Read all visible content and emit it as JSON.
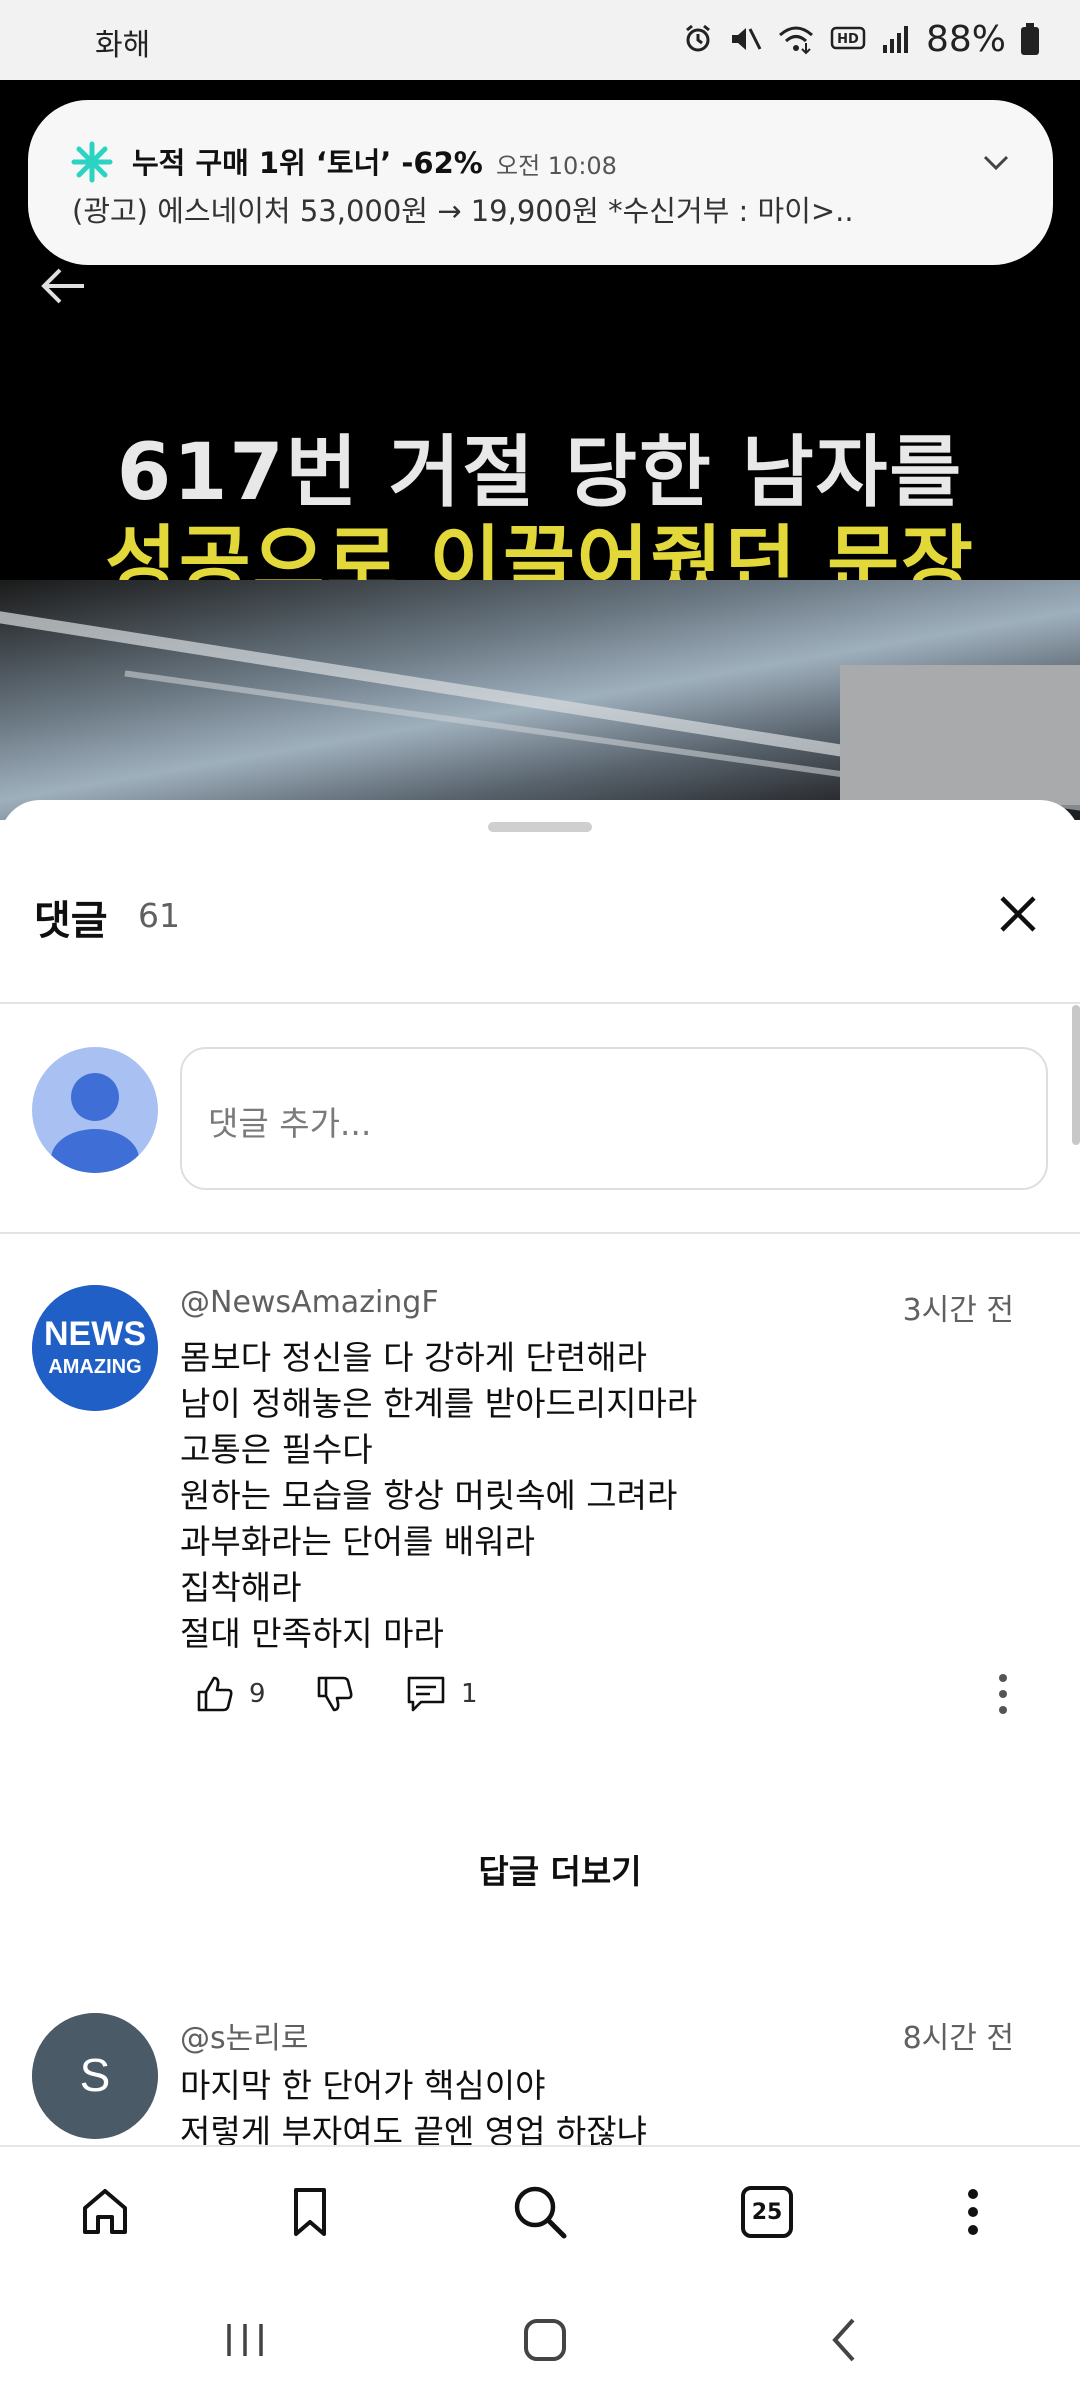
{
  "status_bar": {
    "carrier_label": "화해",
    "battery_percent": "88%",
    "icons": [
      "alarm-icon",
      "mute-icon",
      "wifi-icon",
      "hd-icon",
      "signal-icon",
      "battery-icon"
    ]
  },
  "notification": {
    "title": "누적 구매 1위 ‘토너’ -62%",
    "time": "오전 10:08",
    "body": "(광고) 에스네이처 53,000원 → 19,900원   *수신거부 : 마이>..",
    "icon": "sparkle-icon"
  },
  "video": {
    "title_line1": "617번 거절 당한 남자를",
    "title_line2": "성공으로 이끌어줬던 문장"
  },
  "comments_sheet": {
    "title": "댓글",
    "count": "61",
    "input_placeholder": "댓글 추가...",
    "comments": [
      {
        "author": "@NewsAmazingF",
        "time": "3시간 전",
        "avatar_text_1": "NEWS",
        "avatar_text_2": "AMAZING",
        "lines": [
          "몸보다 정신을 다 강하게 단련해라",
          "남이 정해놓은 한계를 받아드리지마라",
          "고통은 필수다",
          "원하는 모습을 항상 머릿속에 그려라",
          "과부화라는 단어를 배워라",
          "집착해라",
          "절대 만족하지 마라"
        ],
        "likes": "9",
        "replies": "1",
        "more_replies_label": "답글 더보기"
      },
      {
        "author": "@s논리로",
        "time": "8시간 전",
        "avatar_letter": "S",
        "lines": [
          "마지막 한 단어가 핵심이야",
          "저렇게 부자여도 끝엔 영업 하잖냐"
        ]
      }
    ]
  },
  "browser_bar": {
    "tab_count": "25",
    "icons": [
      "home-icon",
      "bookmark-icon",
      "search-icon",
      "tabs-icon",
      "menu-icon"
    ]
  },
  "colors": {
    "accent_yellow": "#e3d83a",
    "avatar_blue": "#1f5fc6",
    "avatar_dark": "#4a5a66",
    "placeholder_avatar": "#a9c1f2"
  }
}
